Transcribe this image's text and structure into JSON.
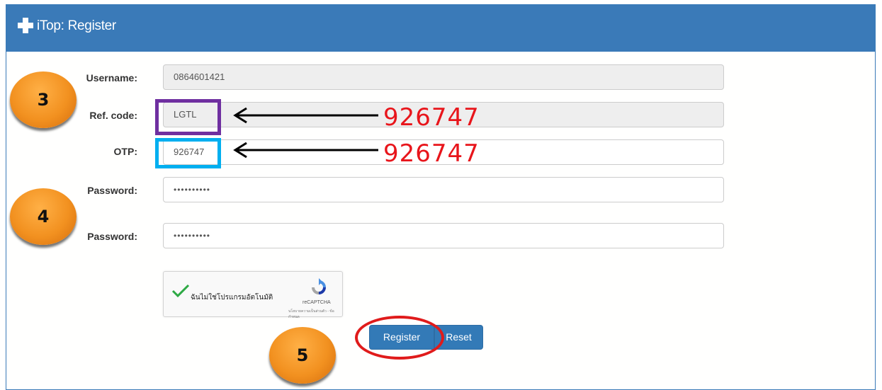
{
  "header": {
    "title": "iTop: Register"
  },
  "form": {
    "username": {
      "label": "Username:",
      "value": "0864601421"
    },
    "ref_code": {
      "label": "Ref. code:",
      "value": "LGTL"
    },
    "otp": {
      "label": "OTP:",
      "value": "926747"
    },
    "password": {
      "label": "Password:",
      "value": "••••••••••"
    },
    "password_confirm": {
      "label": "Password:",
      "value": "••••••••••"
    }
  },
  "captcha": {
    "label": "ฉันไม่ใช่โปรแกรมอัตโนมัติ",
    "brand": "reCAPTCHA",
    "links": "นโยบายความเป็นส่วนตัว - ข้อกำหนด",
    "icon": "recaptcha-logo",
    "checked": true
  },
  "buttons": {
    "register": "Register",
    "reset": "Reset"
  },
  "annotations": {
    "step_3": "3",
    "step_4": "4",
    "step_5": "5",
    "ref_note": "926747",
    "otp_note": "926747",
    "colors": {
      "ref_box": "#6f2fa0",
      "otp_box": "#00aff0",
      "note": "#e8151b",
      "ring": "#e01b1b",
      "badge": "#f29120"
    }
  },
  "colors": {
    "header": "#3a7ab8",
    "button": "#337ab7"
  }
}
